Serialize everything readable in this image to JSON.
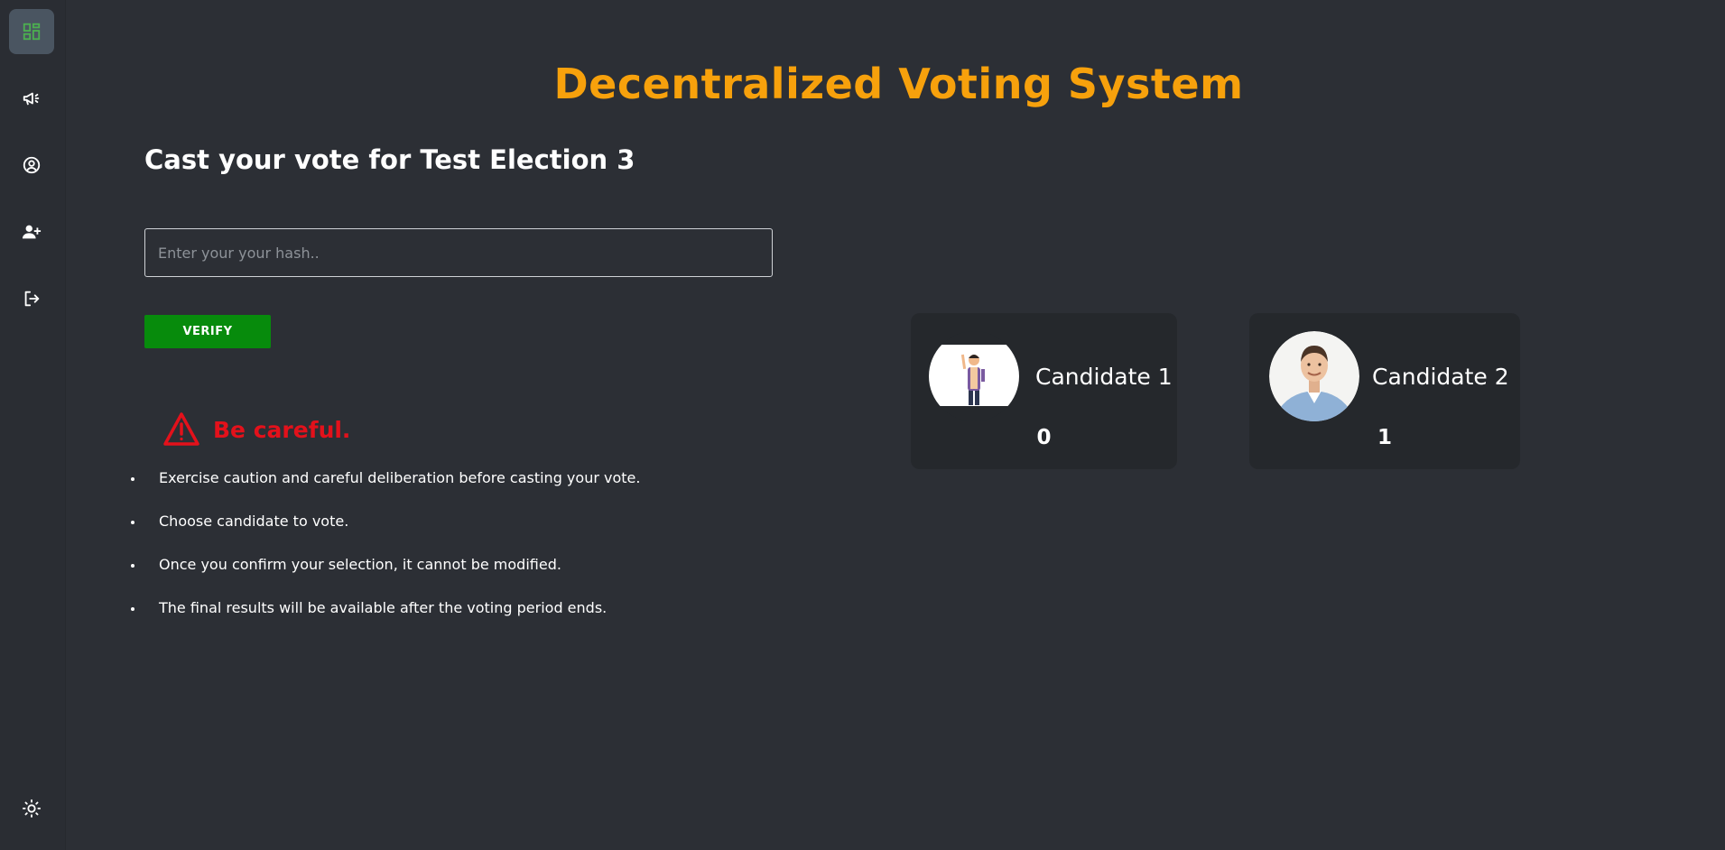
{
  "app": {
    "title": "Decentralized Voting System"
  },
  "sidebar": {
    "items": [
      {
        "icon": "dashboard-icon",
        "active": true
      },
      {
        "icon": "megaphone-icon",
        "active": false
      },
      {
        "icon": "user-circle-icon",
        "active": false
      },
      {
        "icon": "add-user-icon",
        "active": false
      },
      {
        "icon": "logout-icon",
        "active": false
      }
    ],
    "theme_toggle_icon": "sun-icon"
  },
  "election": {
    "heading": "Cast your vote for Test Election 3"
  },
  "hash_input": {
    "value": "",
    "placeholder": "Enter your your hash.."
  },
  "verify_button": {
    "label": "VERIFY"
  },
  "warning": {
    "text": "Be careful.",
    "icon": "warning-triangle-icon"
  },
  "rules": [
    "Exercise caution and careful deliberation before casting your vote.",
    "Choose candidate to vote.",
    "Once you confirm your selection, it cannot be modified.",
    "The final results will be available after the voting period ends."
  ],
  "candidates": [
    {
      "name": "Candidate 1",
      "votes": "0"
    },
    {
      "name": "Candidate 2",
      "votes": "1"
    }
  ],
  "colors": {
    "accent": "#f7a10c",
    "verify": "#078b0c",
    "warning": "#e3111b",
    "background": "#2c2f35",
    "card": "#25282c",
    "active_nav": "#4a5561",
    "active_icon": "#4caf50"
  }
}
